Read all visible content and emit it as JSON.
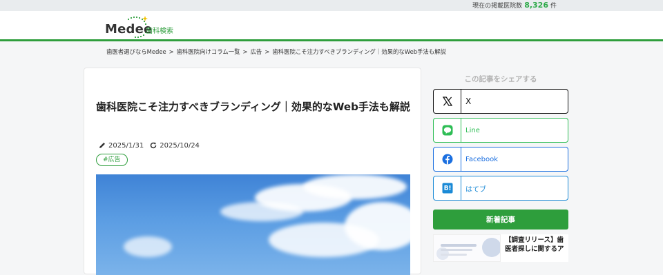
{
  "topbar": {
    "prefix": "現在の掲載医院数",
    "count": "8,326",
    "suffix": "件"
  },
  "logo": {
    "brand": "Medee",
    "subtitle": "歯科検索"
  },
  "breadcrumb": [
    "歯医者選びならMedee",
    "歯科医院向けコラム一覧",
    "広告",
    "歯科医院こそ注力すべきブランディング｜効果的なWeb手法も解説"
  ],
  "breadcrumb_sep": ">",
  "article": {
    "title": "歯科医院こそ注力すべきブランディング｜効果的なWeb手法も解説",
    "published": "2025/1/31",
    "updated": "2025/10/24",
    "tag": "#広告"
  },
  "sidebar": {
    "share_title": "この記事をシェアする",
    "share_buttons": [
      {
        "label": "X",
        "icon": "x-logo-icon"
      },
      {
        "label": "Line",
        "icon": "line-icon"
      },
      {
        "label": "Facebook",
        "icon": "facebook-icon"
      },
      {
        "label": "はてブ",
        "icon": "hatena-bookmark-icon"
      }
    ],
    "new_articles_heading": "新着記事",
    "new_articles": [
      {
        "title": "【調査リリース】歯医者探しに関するア"
      }
    ]
  },
  "colors": {
    "brand_green": "#2e9e3c",
    "line_green": "#2ebd55",
    "facebook_blue": "#1b6fe0",
    "hatena_blue": "#1b8ad6"
  }
}
